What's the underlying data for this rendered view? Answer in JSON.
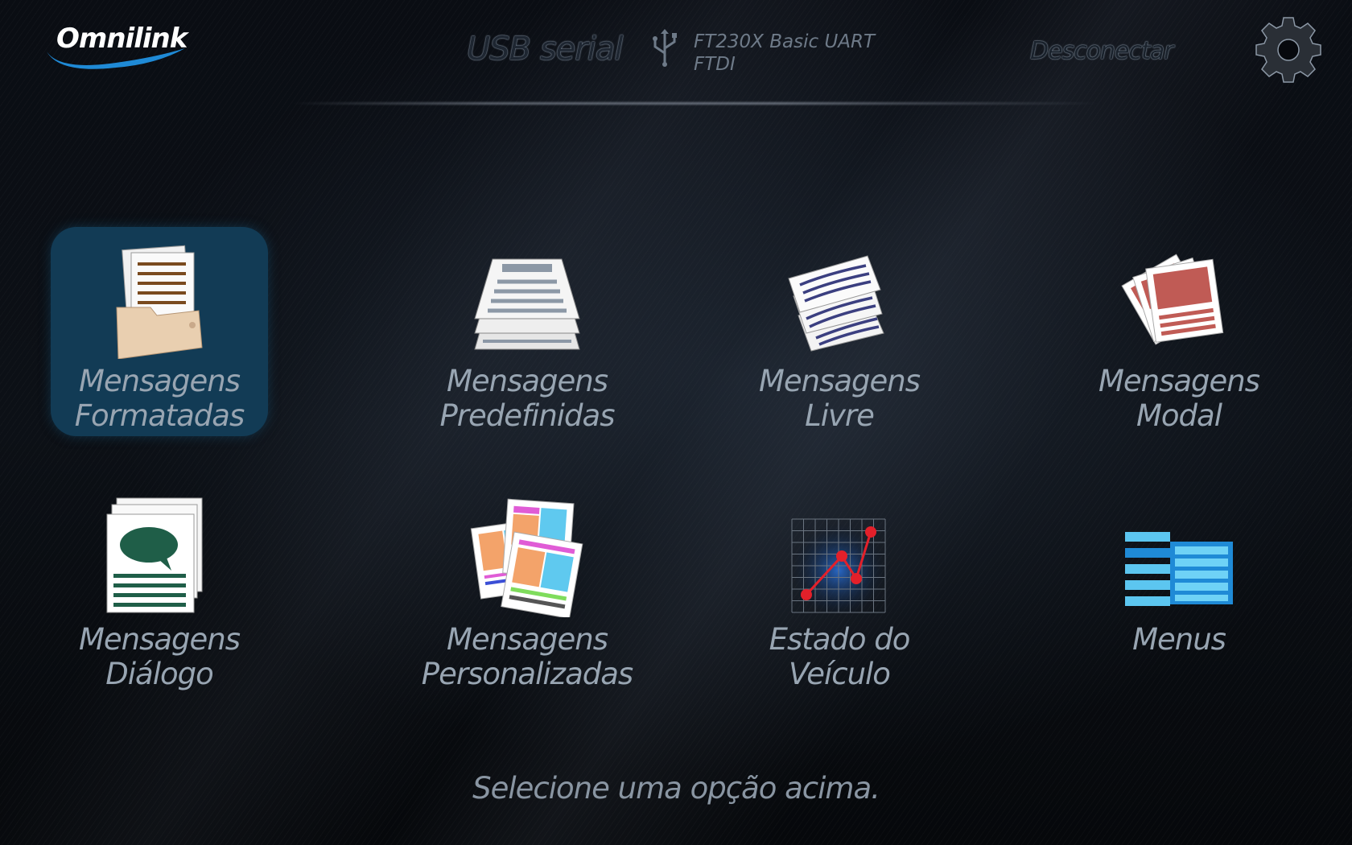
{
  "header": {
    "logo_text": "Omnilink",
    "connection_type": "USB serial",
    "device_line1": "FT230X Basic UART",
    "device_line2": "FTDI",
    "disconnect_label": "Desconectar"
  },
  "tiles": [
    {
      "line1": "Mensagens",
      "line2": "Formatadas",
      "selected": true
    },
    {
      "line1": "Mensagens",
      "line2": "Predefinidas"
    },
    {
      "line1": "Mensagens",
      "line2": "Livre"
    },
    {
      "line1": "Mensagens",
      "line2": "Modal"
    },
    {
      "line1": "Mensagens",
      "line2": "Diálogo"
    },
    {
      "line1": "Mensagens",
      "line2": "Personalizadas"
    },
    {
      "line1": "Estado do",
      "line2": "Veículo"
    },
    {
      "line1": "Menus",
      "line2": ""
    }
  ],
  "status_text": "Selecione uma opção acima.",
  "icons": [
    "folder-documents-icon",
    "stacked-pages-icon",
    "free-text-pages-icon",
    "modal-cards-icon",
    "dialog-document-icon",
    "custom-layout-cards-icon",
    "vehicle-state-chart-icon",
    "menu-list-icon",
    "usb-icon",
    "gear-icon"
  ],
  "colors": {
    "selected_tile": "#123b55",
    "label": "#98a5b2",
    "accent_blue": "#1f8ad6"
  }
}
